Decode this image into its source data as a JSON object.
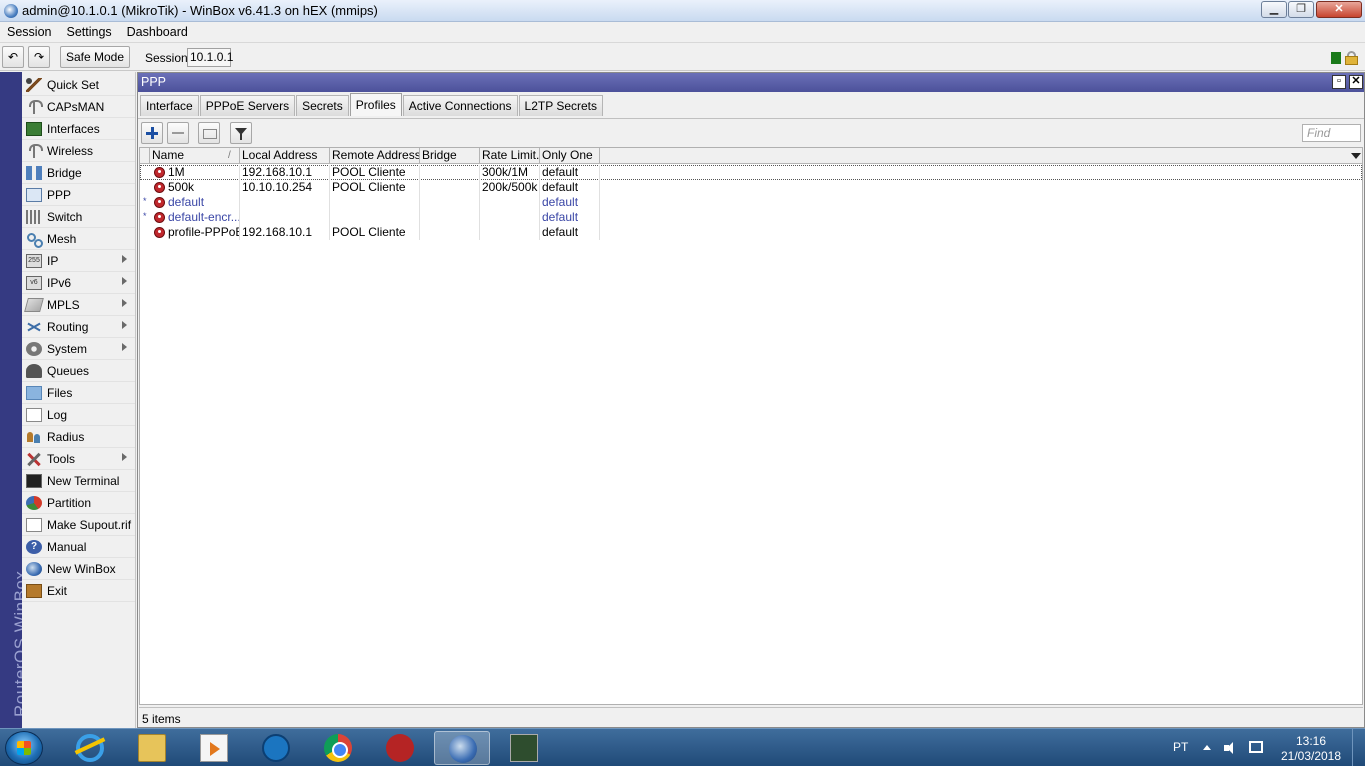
{
  "window": {
    "title": "admin@10.1.0.1 (MikroTik) - WinBox v6.41.3 on hEX (mmips)",
    "min_glyph": "▁",
    "max_glyph": "❐",
    "close_glyph": "✕"
  },
  "menu": [
    "Session",
    "Settings",
    "Dashboard"
  ],
  "toolbar": {
    "undo_glyph": "↶",
    "redo_glyph": "↷",
    "safe_mode_label": "Safe Mode",
    "session_label": "Session:",
    "session_value": "10.1.0.1"
  },
  "brand": "RouterOS WinBox",
  "sidebar": {
    "items": [
      {
        "label": "Quick Set",
        "icon": "wand-icon"
      },
      {
        "label": "CAPsMAN",
        "icon": "antenna-icon"
      },
      {
        "label": "Interfaces",
        "icon": "interface-icon"
      },
      {
        "label": "Wireless",
        "icon": "antenna-icon"
      },
      {
        "label": "Bridge",
        "icon": "bridge-icon"
      },
      {
        "label": "PPP",
        "icon": "ppp-icon"
      },
      {
        "label": "Switch",
        "icon": "switch-icon"
      },
      {
        "label": "Mesh",
        "icon": "mesh-icon"
      },
      {
        "label": "IP",
        "icon": "ip-icon",
        "submenu": true,
        "icon_text": "255"
      },
      {
        "label": "IPv6",
        "icon": "ipv6-icon",
        "submenu": true,
        "icon_text": "v6"
      },
      {
        "label": "MPLS",
        "icon": "mpls-icon",
        "submenu": true
      },
      {
        "label": "Routing",
        "icon": "routing-icon",
        "submenu": true
      },
      {
        "label": "System",
        "icon": "gear-icon",
        "submenu": true
      },
      {
        "label": "Queues",
        "icon": "queues-icon"
      },
      {
        "label": "Files",
        "icon": "folder-icon"
      },
      {
        "label": "Log",
        "icon": "log-icon"
      },
      {
        "label": "Radius",
        "icon": "users-icon"
      },
      {
        "label": "Tools",
        "icon": "tools-icon",
        "submenu": true
      },
      {
        "label": "New Terminal",
        "icon": "terminal-icon"
      },
      {
        "label": "Partition",
        "icon": "pie-icon"
      },
      {
        "label": "Make Supout.rif",
        "icon": "document-icon"
      },
      {
        "label": "Manual",
        "icon": "help-icon",
        "icon_text": "?"
      },
      {
        "label": "New WinBox",
        "icon": "winbox-icon"
      },
      {
        "label": "Exit",
        "icon": "exit-icon"
      }
    ]
  },
  "ppp": {
    "title": "PPP",
    "tabs": [
      "Interface",
      "PPPoE Servers",
      "Secrets",
      "Profiles",
      "Active Connections",
      "L2TP Secrets"
    ],
    "active_tab": "Profiles",
    "find_placeholder": "Find",
    "columns": [
      "Name",
      "Local Address",
      "Remote Address",
      "Bridge",
      "Rate Limit...",
      "Only One"
    ],
    "sort_glyph": "/",
    "rows": [
      {
        "marker": "",
        "name": "1M",
        "local": "192.168.10.1",
        "remote": "POOL Cliente",
        "bridge": "",
        "rate": "300k/1M",
        "only_one": "default",
        "is_default": false
      },
      {
        "marker": "",
        "name": "500k",
        "local": "10.10.10.254",
        "remote": "POOL Cliente",
        "bridge": "",
        "rate": "200k/500k",
        "only_one": "default",
        "is_default": false
      },
      {
        "marker": "*",
        "name": "default",
        "local": "",
        "remote": "",
        "bridge": "",
        "rate": "",
        "only_one": "default",
        "is_default": true
      },
      {
        "marker": "*",
        "name": "default-encr...",
        "local": "",
        "remote": "",
        "bridge": "",
        "rate": "",
        "only_one": "default",
        "is_default": true
      },
      {
        "marker": "",
        "name": "profile-PPPoE",
        "local": "192.168.10.1",
        "remote": "POOL Cliente",
        "bridge": "",
        "rate": "",
        "only_one": "default",
        "is_default": false
      }
    ],
    "status": "5 items"
  },
  "taskbar": {
    "items": [
      "internet-explorer-icon",
      "file-explorer-icon",
      "media-player-icon",
      "ccleaner-icon",
      "chrome-icon",
      "bit-defender-icon",
      "winbox-icon",
      "tool-icon"
    ],
    "lang": "PT",
    "time": "13:16",
    "date": "21/03/2018"
  }
}
